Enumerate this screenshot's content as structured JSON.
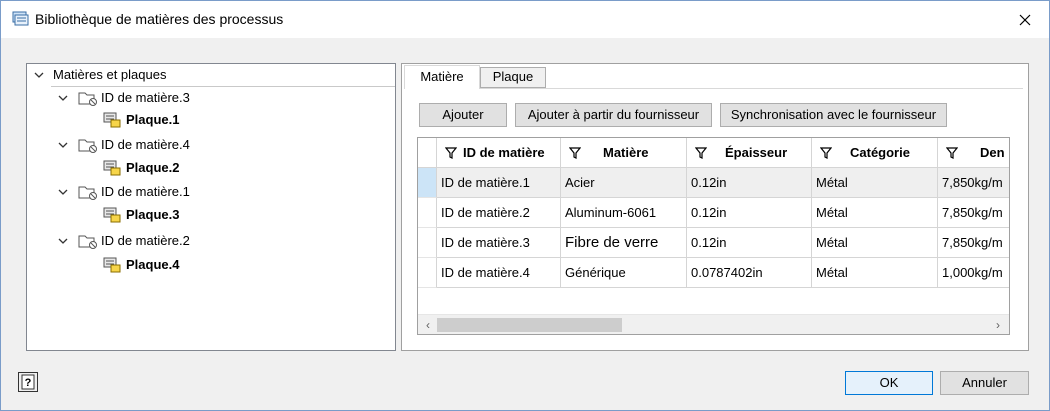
{
  "window": {
    "title": "Bibliothèque de matières des processus"
  },
  "tree": {
    "root_label": "Matières et plaques",
    "items": [
      {
        "label": "ID de matière.3",
        "plate": "Plaque.1"
      },
      {
        "label": "ID de matière.4",
        "plate": "Plaque.2"
      },
      {
        "label": "ID de matière.1",
        "plate": "Plaque.3"
      },
      {
        "label": "ID de matière.2",
        "plate": "Plaque.4"
      }
    ]
  },
  "tabs": [
    {
      "label": "Matière"
    },
    {
      "label": "Plaque"
    }
  ],
  "toolbar": {
    "add_label": "Ajouter",
    "add_from_supplier_label": "Ajouter à partir du fournisseur",
    "sync_label": "Synchronisation avec le fournisseur"
  },
  "table": {
    "columns": [
      "ID de matière",
      "Matière",
      "Épaisseur",
      "Catégorie",
      "Den"
    ],
    "rows": [
      [
        "ID de matière.1",
        "Acier",
        "0.12in",
        "Métal",
        "7,850kg/m"
      ],
      [
        "ID de matière.2",
        "Aluminum-6061",
        "0.12in",
        "Métal",
        "7,850kg/m"
      ],
      [
        "ID de matière.3",
        "Fibre de verre",
        "0.12in",
        "Métal",
        "7,850kg/m"
      ],
      [
        "ID de matière.4",
        "Générique",
        "0.0787402in",
        "Métal",
        "1,000kg/m"
      ]
    ]
  },
  "footer": {
    "ok_label": "OK",
    "cancel_label": "Annuler"
  }
}
